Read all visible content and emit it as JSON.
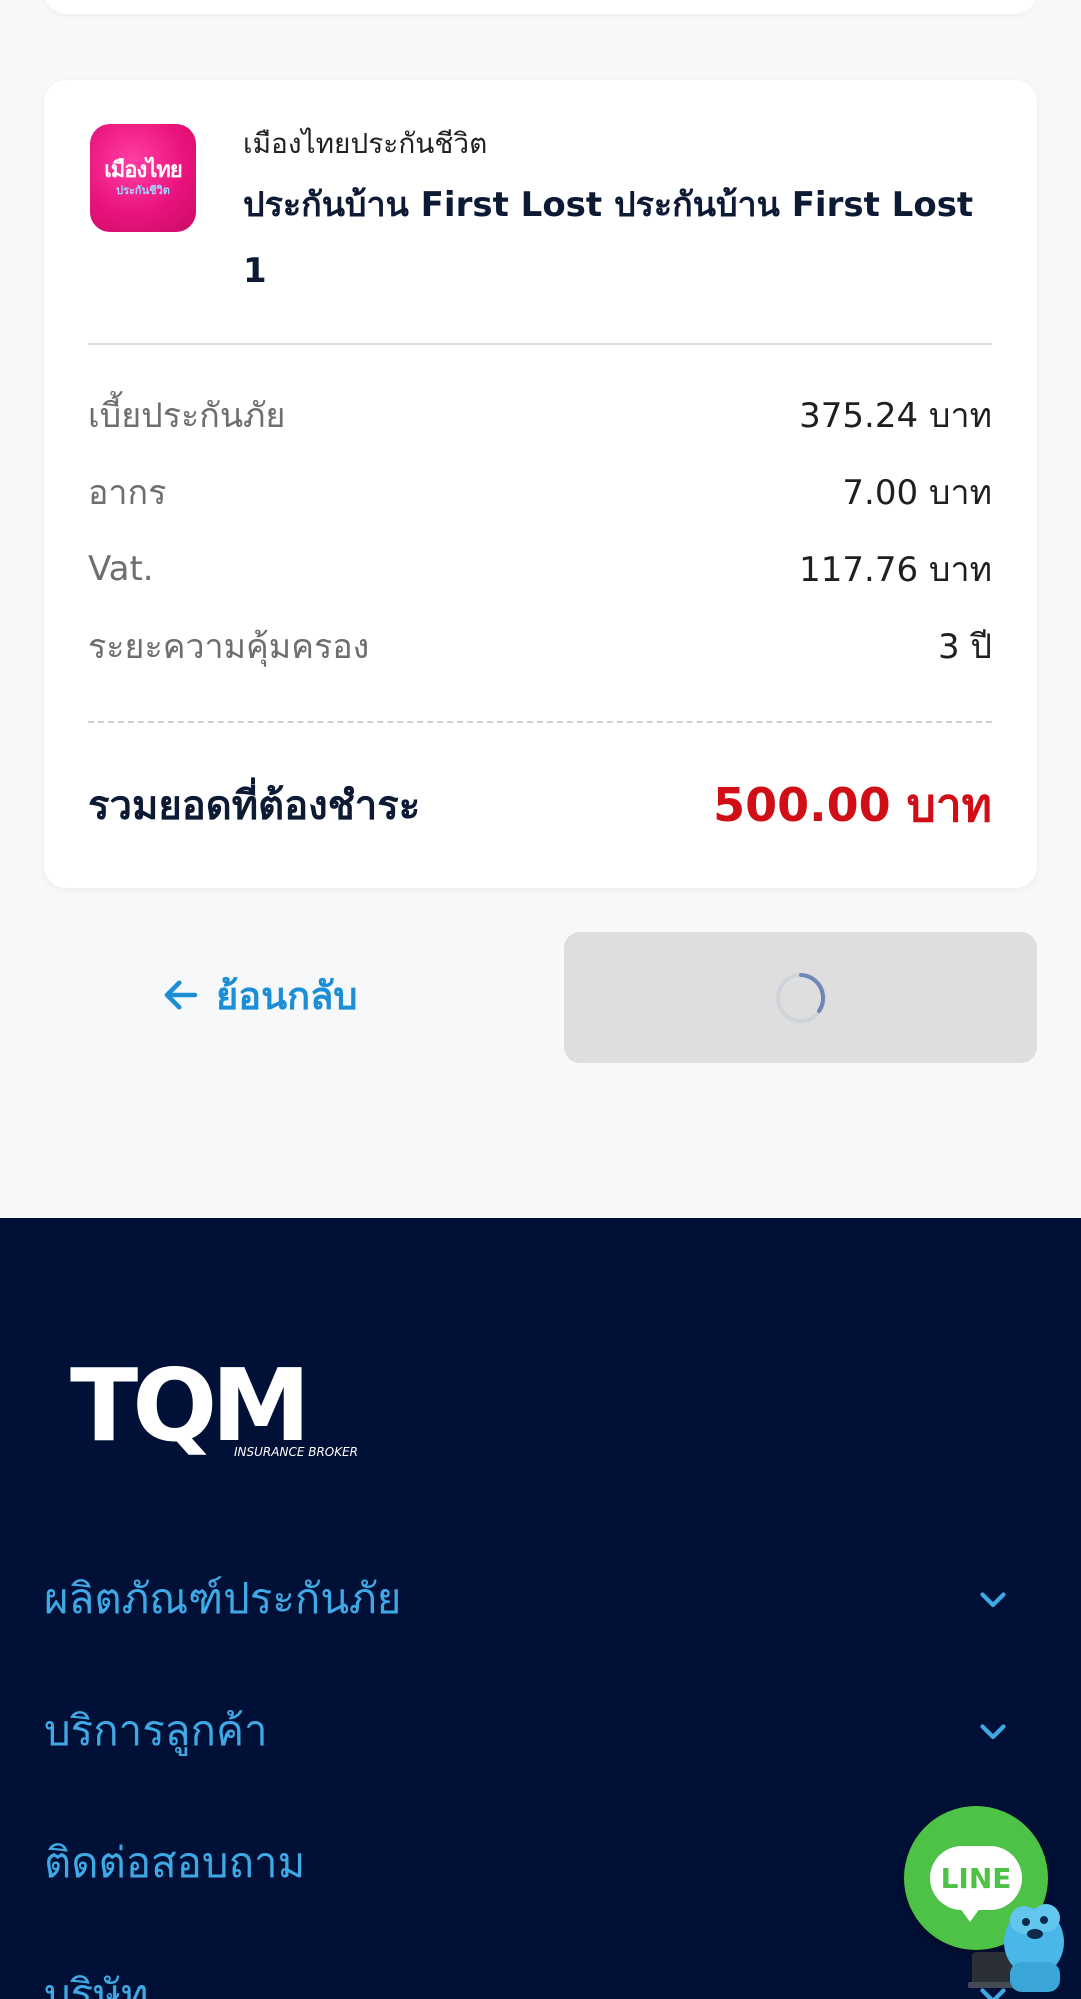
{
  "summary": {
    "insurer_logo": {
      "line1": "เมืองไทย",
      "line2": "ประกันชีวิต"
    },
    "insurer_name": "เมืองไทยประกันชีวิต",
    "product_name": "ประกันบ้าน First Lost ประกันบ้าน First Lost 1",
    "rows": [
      {
        "label": "เบี้ยประกันภัย",
        "value": "375.24 บาท"
      },
      {
        "label": "อากร",
        "value": "7.00 บาท"
      },
      {
        "label": "Vat.",
        "value": "117.76 บาท"
      },
      {
        "label": "ระยะความคุ้มครอง",
        "value": "3 ปี"
      }
    ],
    "total_label": "รวมยอดที่ต้องชำระ",
    "total_value": "500.00 บาท"
  },
  "actions": {
    "back_label": "ย้อนกลับ",
    "back_icon": "arrow-left-icon",
    "submit_state": "loading"
  },
  "footer": {
    "logo_text": "TQM",
    "logo_sub": "INSURANCE BROKER",
    "menu": [
      {
        "label": "ผลิตภัณฑ์ประกันภัย",
        "icon": "chevron-down-icon"
      },
      {
        "label": "บริการลูกค้า",
        "icon": "chevron-down-icon"
      },
      {
        "label": "ติดต่อสอบถาม",
        "icon": "chevron-down-icon"
      },
      {
        "label": "บริษัท",
        "icon": "chevron-down-icon"
      }
    ]
  },
  "chat": {
    "label": "LINE"
  },
  "colors": {
    "accent": "#1b8ed6",
    "total": "#d10d15",
    "footer_bg": "#011036",
    "footer_link": "#3fa9e6",
    "line_green": "#4dc247"
  }
}
